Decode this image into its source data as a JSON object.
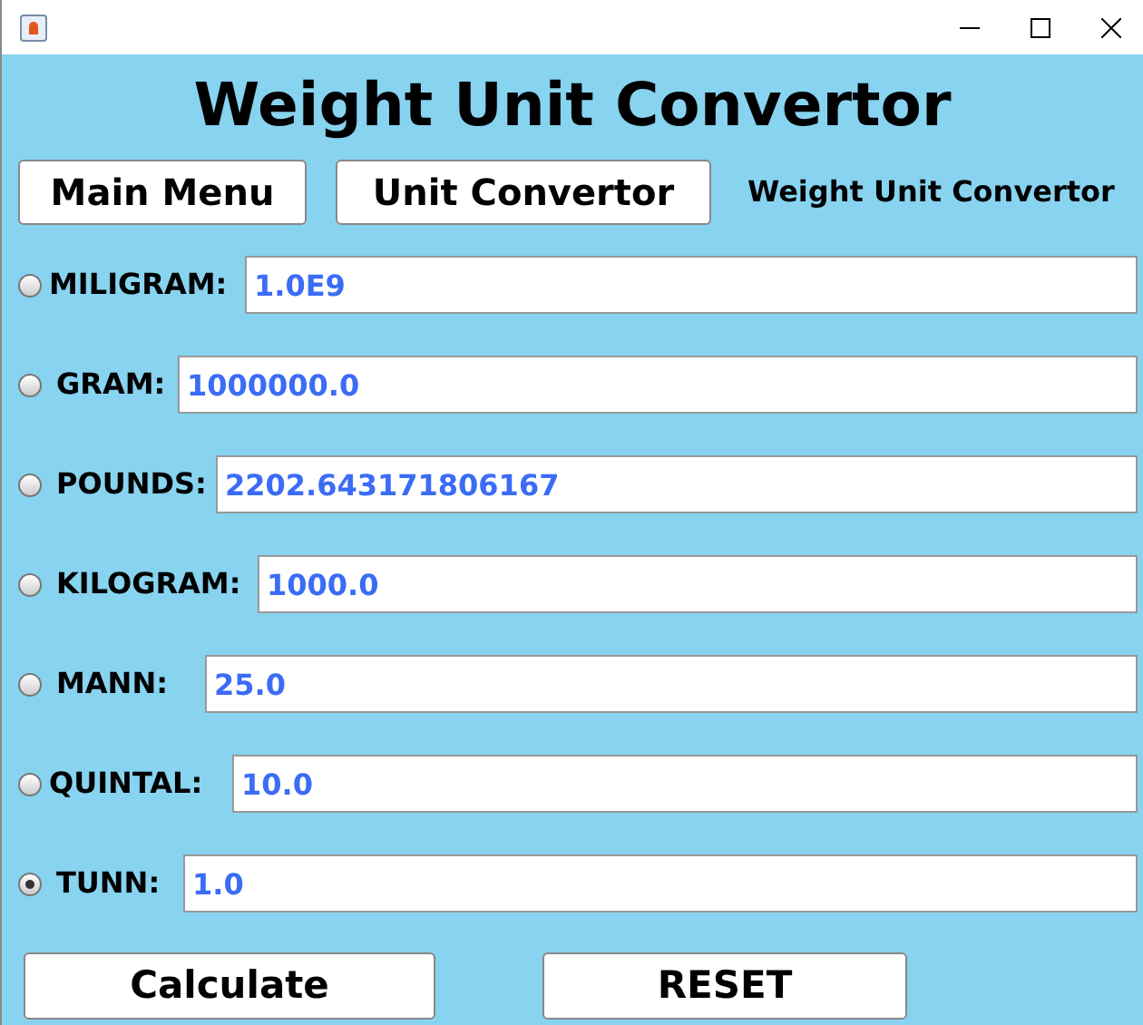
{
  "heading": "Weight Unit Convertor",
  "nav_buttons": [
    "Main Menu",
    "Unit Convertor"
  ],
  "subtitle": "Weight Unit Convertor",
  "units": [
    {
      "label": "MILIGRAM:",
      "value": "1.0E9",
      "selected": false
    },
    {
      "label": "GRAM:",
      "value": "1000000.0",
      "selected": false
    },
    {
      "label": "POUNDS:",
      "value": "2202.643171806167",
      "selected": false
    },
    {
      "label": "KILOGRAM:",
      "value": "1000.0",
      "selected": false
    },
    {
      "label": "MANN:",
      "value": "25.0",
      "selected": false
    },
    {
      "label": "QUINTAL:",
      "value": "10.0",
      "selected": false
    },
    {
      "label": "TUNN:",
      "value": "1.0",
      "selected": true
    }
  ],
  "actions": [
    "Calculate",
    "RESET"
  ]
}
